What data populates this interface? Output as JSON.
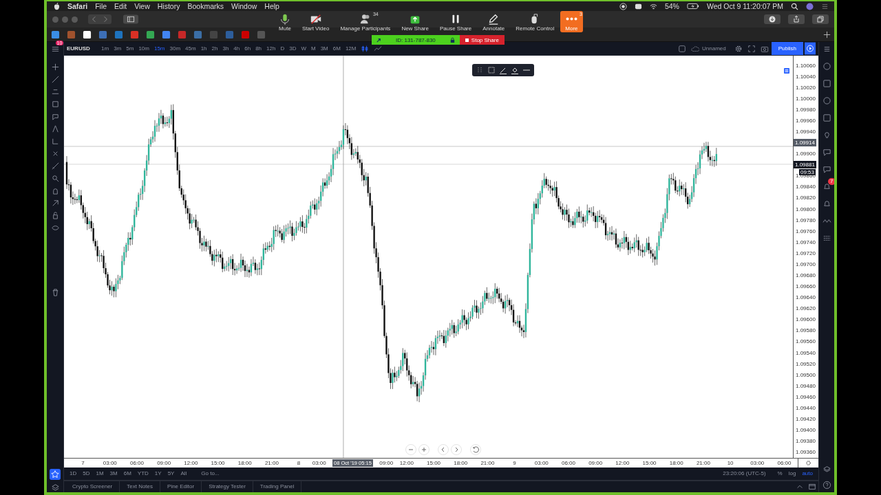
{
  "menu_bar": {
    "app": "Safari",
    "items": [
      "File",
      "Edit",
      "View",
      "History",
      "Bookmarks",
      "Window",
      "Help"
    ],
    "battery": "54%",
    "clock": "Wed Oct 9  11:20:07 PM"
  },
  "zoom_toolbar": {
    "buttons": [
      {
        "label": "Mute",
        "kind": "mic"
      },
      {
        "label": "Start Video",
        "kind": "video"
      },
      {
        "label": "Manage Participants",
        "kind": "people",
        "badge": "34"
      },
      {
        "label": "New Share",
        "kind": "share"
      },
      {
        "label": "Pause Share",
        "kind": "pause"
      },
      {
        "label": "Annotate",
        "kind": "pen"
      },
      {
        "label": "Remote Control",
        "kind": "mouse"
      },
      {
        "label": "More",
        "kind": "more",
        "badge": "3"
      }
    ],
    "meeting_id": "ID: 131-787-830",
    "stop_label": "Stop Share"
  },
  "tv_toolbar": {
    "menu_badge": "10",
    "symbol": "EURUSD",
    "intervals": [
      {
        "label": "1m",
        "selected": false
      },
      {
        "label": "3m",
        "selected": false
      },
      {
        "label": "5m",
        "selected": false
      },
      {
        "label": "10m",
        "selected": false
      },
      {
        "label": "15m",
        "selected": true
      },
      {
        "label": "30m",
        "selected": false
      },
      {
        "label": "45m",
        "selected": false
      },
      {
        "label": "1h",
        "selected": false
      },
      {
        "label": "2h",
        "selected": false
      },
      {
        "label": "3h",
        "selected": false
      },
      {
        "label": "4h",
        "selected": false
      },
      {
        "label": "6h",
        "selected": false
      },
      {
        "label": "8h",
        "selected": false
      },
      {
        "label": "12h",
        "selected": false
      },
      {
        "label": "D",
        "selected": false
      },
      {
        "label": "3D",
        "selected": false
      },
      {
        "label": "W",
        "selected": false
      },
      {
        "label": "M",
        "selected": false
      },
      {
        "label": "3M",
        "selected": false
      },
      {
        "label": "6M",
        "selected": false
      },
      {
        "label": "12M",
        "selected": false
      }
    ],
    "layout_name": "Unnamed",
    "publish": "Publish"
  },
  "price_axis": {
    "ticks": [
      {
        "text": "1.10060",
        "kind": "tick"
      },
      {
        "text": "1.10040",
        "kind": "tick"
      },
      {
        "text": "1.10020",
        "kind": "tick"
      },
      {
        "text": "1.10000",
        "kind": "tick"
      },
      {
        "text": "1.09980",
        "kind": "tick"
      },
      {
        "text": "1.09960",
        "kind": "tick"
      },
      {
        "text": "1.09940",
        "kind": "tick"
      },
      {
        "text": "1.09914",
        "kind": "last"
      },
      {
        "text": "1.09900",
        "kind": "tick"
      },
      {
        "text": "1.09881",
        "kind": "current",
        "sub": "09:53"
      },
      {
        "text": "1.09860",
        "kind": "tick"
      },
      {
        "text": "1.09840",
        "kind": "tick"
      },
      {
        "text": "1.09820",
        "kind": "tick"
      },
      {
        "text": "1.09800",
        "kind": "tick"
      },
      {
        "text": "1.09780",
        "kind": "tick"
      },
      {
        "text": "1.09760",
        "kind": "tick"
      },
      {
        "text": "1.09740",
        "kind": "tick"
      },
      {
        "text": "1.09720",
        "kind": "tick"
      },
      {
        "text": "1.09700",
        "kind": "tick"
      },
      {
        "text": "1.09680",
        "kind": "tick"
      },
      {
        "text": "1.09660",
        "kind": "tick"
      },
      {
        "text": "1.09640",
        "kind": "tick"
      },
      {
        "text": "1.09620",
        "kind": "tick"
      },
      {
        "text": "1.09600",
        "kind": "tick"
      },
      {
        "text": "1.09580",
        "kind": "tick"
      },
      {
        "text": "1.09560",
        "kind": "tick"
      },
      {
        "text": "1.09540",
        "kind": "tick"
      },
      {
        "text": "1.09520",
        "kind": "tick"
      },
      {
        "text": "1.09500",
        "kind": "tick"
      },
      {
        "text": "1.09480",
        "kind": "tick"
      },
      {
        "text": "1.09460",
        "kind": "tick"
      },
      {
        "text": "1.09440",
        "kind": "tick"
      },
      {
        "text": "1.09420",
        "kind": "tick"
      },
      {
        "text": "1.09400",
        "kind": "tick"
      },
      {
        "text": "1.09380",
        "kind": "tick"
      },
      {
        "text": "1.09360",
        "kind": "tick"
      }
    ]
  },
  "time_axis": {
    "labels": [
      {
        "text": "7",
        "kind": "tick"
      },
      {
        "text": "03:00",
        "kind": "tick"
      },
      {
        "text": "06:00",
        "kind": "tick"
      },
      {
        "text": "09:00",
        "kind": "tick"
      },
      {
        "text": "12:00",
        "kind": "tick"
      },
      {
        "text": "15:00",
        "kind": "tick"
      },
      {
        "text": "18:00",
        "kind": "tick"
      },
      {
        "text": "21:00",
        "kind": "tick"
      },
      {
        "text": "8",
        "kind": "tick"
      },
      {
        "text": "03:00",
        "kind": "tick"
      },
      {
        "text": "08 Oct '19 05:15",
        "kind": "crosshair"
      },
      {
        "text": "09:00",
        "kind": "tick"
      },
      {
        "text": "12:00",
        "kind": "tick"
      },
      {
        "text": "15:00",
        "kind": "tick"
      },
      {
        "text": "18:00",
        "kind": "tick"
      },
      {
        "text": "21:00",
        "kind": "tick"
      },
      {
        "text": "9",
        "kind": "tick"
      },
      {
        "text": "03:00",
        "kind": "tick"
      },
      {
        "text": "06:00",
        "kind": "tick"
      },
      {
        "text": "09:00",
        "kind": "tick"
      },
      {
        "text": "12:00",
        "kind": "tick"
      },
      {
        "text": "15:00",
        "kind": "tick"
      },
      {
        "text": "18:00",
        "kind": "tick"
      },
      {
        "text": "21:00",
        "kind": "tick"
      },
      {
        "text": "10",
        "kind": "tick"
      },
      {
        "text": "03:00",
        "kind": "tick"
      },
      {
        "text": "06:00",
        "kind": "tick"
      }
    ]
  },
  "range_bar": {
    "ranges": [
      "1D",
      "5D",
      "1M",
      "3M",
      "6M",
      "YTD",
      "1Y",
      "5Y",
      "All"
    ],
    "goto": "Go to...",
    "clock": "23:20:06 (UTC-5)",
    "scales": [
      {
        "label": "%",
        "selected": false
      },
      {
        "label": "log",
        "selected": false
      },
      {
        "label": "auto",
        "selected": true
      }
    ]
  },
  "bottom_tabs": [
    "Crypto Screener",
    "Text Notes",
    "Pine Editor",
    "Strategy Tester",
    "Trading Panel"
  ],
  "right_toolbar": {
    "alert_badge": "7"
  }
}
